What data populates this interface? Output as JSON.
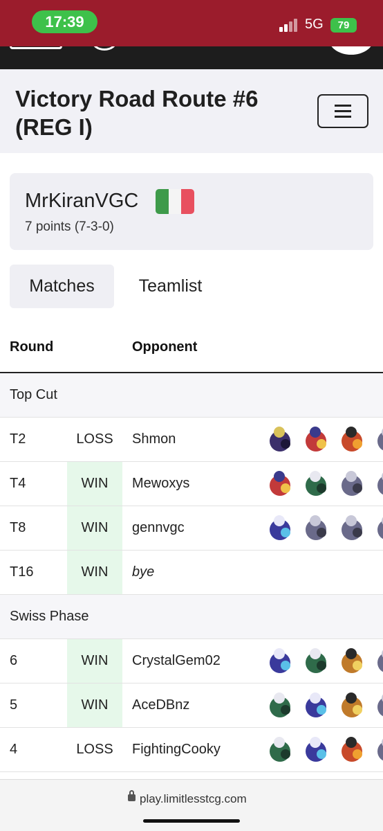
{
  "status_bar": {
    "time": "17:39",
    "network": "5G",
    "battery": "79"
  },
  "page": {
    "title": "Victory Road Route #6 (REG I)"
  },
  "player": {
    "name": "MrKiranVGC",
    "record": "7 points (7-3-0)",
    "flag_colors": [
      "#3e9a4a",
      "#f4f4f4",
      "#e8505f"
    ]
  },
  "tabs": [
    {
      "label": "Matches",
      "active": true
    },
    {
      "label": "Teamlist",
      "active": false
    }
  ],
  "table": {
    "headers": {
      "round": "Round",
      "opponent": "Opponent"
    },
    "sections": [
      {
        "label": "Top Cut",
        "rows": [
          {
            "round": "T2",
            "result": "LOSS",
            "opponent": "Shmon",
            "team": [
              "lunala-icon",
              "koraidon-icon",
              "incineroar-icon",
              "pokemon-icon"
            ]
          },
          {
            "round": "T4",
            "result": "WIN",
            "opponent": "Mewoxys",
            "team": [
              "koraidon-icon",
              "calyrex-icon",
              "pokemon-icon",
              "pokemon-icon"
            ]
          },
          {
            "round": "T8",
            "result": "WIN",
            "opponent": "gennvgc",
            "team": [
              "miraidon-icon",
              "pokemon-icon",
              "pokemon-icon",
              "pokemon-icon"
            ]
          },
          {
            "round": "T16",
            "result": "WIN",
            "opponent": "bye",
            "team": []
          }
        ]
      },
      {
        "label": "Swiss Phase",
        "rows": [
          {
            "round": "6",
            "result": "WIN",
            "opponent": "CrystalGem02",
            "team": [
              "miraidon-icon",
              "calyrex-icon",
              "farigiraf-icon",
              "pokemon-icon"
            ]
          },
          {
            "round": "5",
            "result": "WIN",
            "opponent": "AceDBnz",
            "team": [
              "calyrex-icon",
              "miraidon-icon",
              "farigiraf-icon",
              "pokemon-icon"
            ]
          },
          {
            "round": "4",
            "result": "LOSS",
            "opponent": "FightingCooky",
            "team": [
              "calyrex-icon",
              "miraidon-icon",
              "incineroar-icon",
              "pokemon-icon"
            ]
          }
        ]
      }
    ]
  },
  "browser": {
    "url": "play.limitlesstcg.com"
  },
  "colors": {
    "status_bar": "#9b1c2c",
    "win_cell": "#e6f8ea",
    "card_bg": "#efeff4"
  }
}
